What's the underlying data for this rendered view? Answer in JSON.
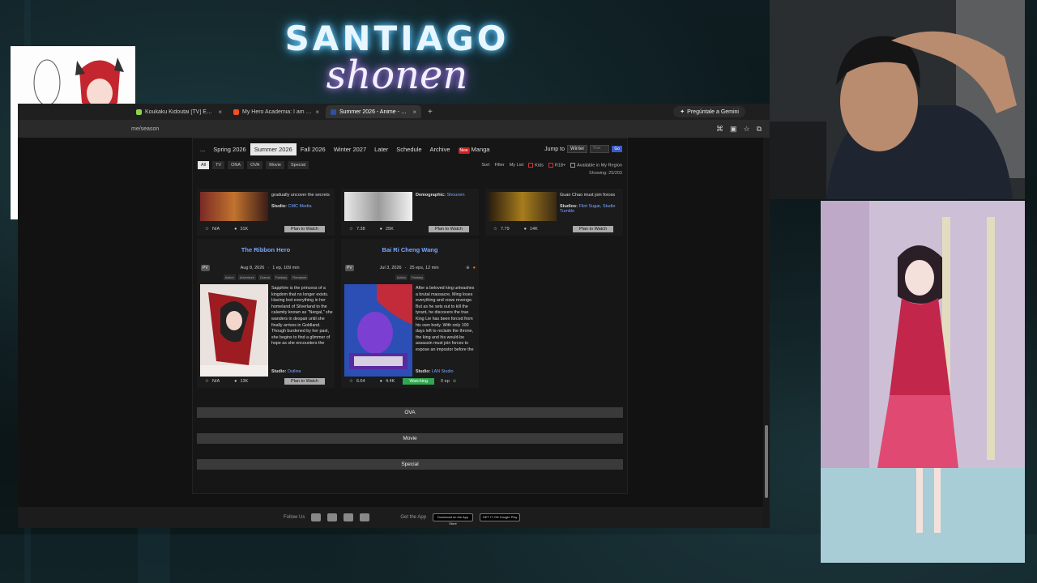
{
  "overlay": {
    "logo_line1": "SANTIAGO",
    "logo_line2": "shonen"
  },
  "browser": {
    "tabs": [
      {
        "label": "Koukaku Kidoutai [TV] Episodi...",
        "active": false,
        "color": "#8fd14f"
      },
      {
        "label": "My Hero Academia: I am a her...",
        "active": false,
        "color": "#f25022"
      },
      {
        "label": "Summer 2026 - Anime - MyAni...",
        "active": true,
        "color": "#2e51a2"
      }
    ],
    "new_tab": "+",
    "gemini_label": "Pregúntale a Gemini",
    "address": "me/season"
  },
  "season_nav": {
    "items": [
      "...",
      "Spring 2026",
      "Summer 2026",
      "Fall 2026",
      "Winter 2027",
      "Later",
      "Schedule",
      "Archive"
    ],
    "active": "Summer 2026",
    "new_badge": "New",
    "manga": "Manga",
    "jump_label": "Jump to",
    "jump_select": "Winter",
    "year_placeholder": "Year",
    "go": "Go"
  },
  "filters": {
    "types": [
      "All",
      "TV",
      "ONA",
      "OVA",
      "Movie",
      "Special"
    ],
    "active": "All",
    "sort": "Sort",
    "filter": "Filter",
    "mylist": "My List",
    "kids": "Kids",
    "r18": "R18+",
    "region": "Available in My Region",
    "showing": "Showing: 25/203"
  },
  "top_cards": [
    {
      "synopsis": "gradually uncover the secrets",
      "studio_label": "Studio:",
      "studio": "CMC Media",
      "score": "N/A",
      "members": "31K",
      "button": "Plan to Watch"
    },
    {
      "demographic_label": "Demographic:",
      "demographic": "Shounen",
      "score": "7.38",
      "members": "25K",
      "button": "Plan to Watch"
    },
    {
      "synopsis": "Guan Chao must join forces",
      "studio_label": "Studios:",
      "studio": "Flint Sugar, Studio Tumble",
      "score": "7.79",
      "members": "14K",
      "button": "Plan to Watch"
    }
  ],
  "cards": [
    {
      "title": "The Ribbon Hero",
      "pv": "PV",
      "date": "Aug 8, 2026",
      "eps": "1 ep, 109 min",
      "genres": [
        "Action",
        "Adventure",
        "Drama",
        "Fantasy",
        "Romance"
      ],
      "synopsis": "Sapphire is the princess of a kingdom that no longer exists. Having lost everything in her homeland of Silverland to the calamity known as \"Nergal,\" she wanders in despair until she finally arrives in Goldland. Though burdened by her past, she begins to find a glimmer of hope as she encounters the",
      "studio_label": "Studio:",
      "studio": "Outline",
      "score": "N/A",
      "members": "13K",
      "button": "Plan to Watch"
    },
    {
      "title": "Bai Ri Cheng Wang",
      "pv": "PV",
      "date": "Jul 3, 2026",
      "eps": "25 eps, 12 min",
      "genres": [
        "Action",
        "Fantasy"
      ],
      "synopsis": "After a beloved king unleashes a brutal massacre, Ming loses everything and vows revenge. But as he sets out to kill the tyrant, he discovers the true King Lie has been forced from his own body. With only 100 days left to reclaim the throne, the king and his would-be assassin must join forces to expose an impostor before the",
      "studio_label": "Studio:",
      "studio": "LAN Studio",
      "score": "6.64",
      "members": "4.4K",
      "button": "Watching",
      "progress": "0 ep"
    }
  ],
  "sections": [
    "OVA",
    "Movie",
    "Special"
  ],
  "footer": {
    "follow": "Follow Us",
    "get_app": "Get the App",
    "app_store": "Download on the App Store",
    "google_play": "GET IT ON Google Play"
  }
}
